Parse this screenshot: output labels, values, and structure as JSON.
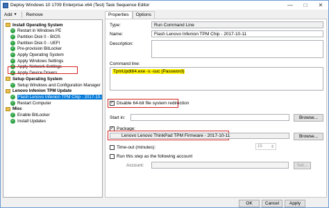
{
  "window": {
    "title": "Deploy Windows 10 1709 Enterprise x64 (Test) Task Sequence Editor"
  },
  "toolbar": {
    "add_label": "Add",
    "remove_label": "Remove"
  },
  "tabs": [
    {
      "label": "Properties"
    },
    {
      "label": "Options"
    }
  ],
  "tree": [
    {
      "label": "Install Operating System",
      "type": "group"
    },
    {
      "label": "Restart in Windows PE",
      "type": "step"
    },
    {
      "label": "Partition Disk 0 - BIOS",
      "type": "step"
    },
    {
      "label": "Partition Disk 0 - UEFI",
      "type": "step"
    },
    {
      "label": "Pre-provision BitLocker",
      "type": "step"
    },
    {
      "label": "Apply Operating System",
      "type": "step"
    },
    {
      "label": "Apply Windows Settings",
      "type": "step"
    },
    {
      "label": "Apply Network Settings",
      "type": "step"
    },
    {
      "label": "Apply Device Drivers",
      "type": "step"
    },
    {
      "label": "Setup Operating System",
      "type": "group"
    },
    {
      "label": "Setup Windows and Configuration Manager",
      "type": "step"
    },
    {
      "label": "Lenovo Infenion TPM Update",
      "type": "group"
    },
    {
      "label": "Flash Lenovo Infenion TPM Chip - 2017-10-11",
      "type": "step",
      "selected": true
    },
    {
      "label": "Restart Computer",
      "type": "step"
    },
    {
      "label": "Misc",
      "type": "group"
    },
    {
      "label": "Enable BitLocker",
      "type": "step"
    },
    {
      "label": "Install Updates",
      "type": "step"
    }
  ],
  "props": {
    "type_label": "Type:",
    "type_value": "Run Command Line",
    "name_label": "Name:",
    "name_value": "Flash Lenovo Infenion TPM Chip - 2017-10-11",
    "description_label": "Description:",
    "description_value": "",
    "command_line_label": "Command line:",
    "command_line_value": "TpmUpdt64.exe -s -suc {Password}",
    "disable_redirection_label": "Disable 64-bit file system redirection",
    "disable_redirection_checked": true,
    "start_in_label": "Start in:",
    "start_in_value": "",
    "browse_label": "Browse...",
    "package_label": "Package:",
    "package_checked": true,
    "package_value": "Lenovo Lenovo ThinkPad TPM Firmware - 2017-10-11",
    "package_browse_label": "Browse...",
    "timeout_label": "Time-out (minutes):",
    "timeout_checked": false,
    "timeout_value": "15",
    "run_as_label": "Run this step as the following account",
    "run_as_checked": false,
    "account_label": "Account:",
    "account_value": "",
    "set_label": "Set..."
  },
  "footer": {
    "ok_label": "OK",
    "cancel_label": "Cancel",
    "apply_label": "Apply"
  }
}
